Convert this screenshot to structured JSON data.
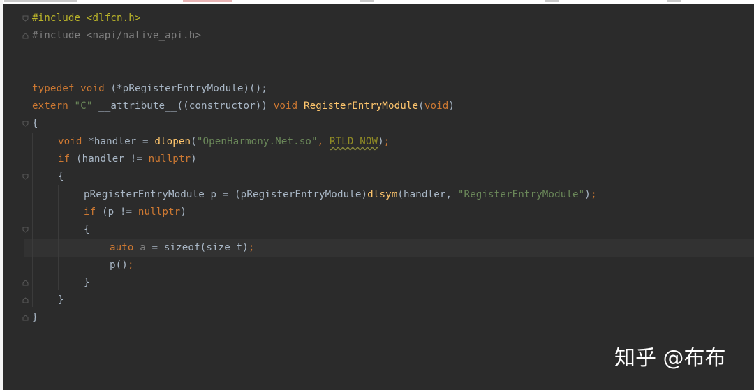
{
  "code": {
    "l1_dir": "#include",
    "l1_hdr": "<dlfcn.h>",
    "l2_dir": "#include",
    "l2_hdr": "<napi/native_api.h>",
    "l5_kw": "typedef",
    "l5_void": "void",
    "l5_rest": "(*pRegisterEntryModule)();",
    "l6_kw": "extern",
    "l6_str": "\"C\"",
    "l6_attr": "__attribute__((constructor))",
    "l6_void": "void",
    "l6_fn": "RegisterEntryModule",
    "l6_open": "(",
    "l6_param": "void",
    "l6_close": ")",
    "l7": "{",
    "l8_void": "void",
    "l8_mid": "*handler =",
    "l8_fn": "dlopen",
    "l8_open": "(",
    "l8_str": "\"OpenHarmony.Net.so\"",
    "l8_comma": ",",
    "l8_macro": "RTLD_NOW",
    "l8_close": ")",
    "l8_semi": ";",
    "l9_kw": "if",
    "l9_mid": "(handler !=",
    "l9_null": "nullptr",
    "l9_close": ")",
    "l10": "{",
    "l11_a": "pRegisterEntryModule p = (pRegisterEntryModule)",
    "l11_fn": "dlsym",
    "l11_b": "(handler,",
    "l11_str": "\"RegisterEntryModule\"",
    "l11_c": ")",
    "l11_semi": ";",
    "l12_kw": "if",
    "l12_mid": "(p !=",
    "l12_null": "nullptr",
    "l12_close": ")",
    "l13": "{",
    "l14_kw": "auto",
    "l14_var": "a",
    "l14_rest": "= sizeof(size_t)",
    "l14_semi": ";",
    "l15_a": "p()",
    "l15_semi": ";",
    "l16": "}",
    "l17": "}",
    "l18": "}"
  },
  "watermark": "知乎 @布布",
  "colors": {
    "background": "#2b2b2b",
    "keyword": "#cc7832",
    "preprocessor": "#bbb529",
    "string": "#6a8759",
    "function": "#ffc66d",
    "text": "#a9b7c6"
  }
}
